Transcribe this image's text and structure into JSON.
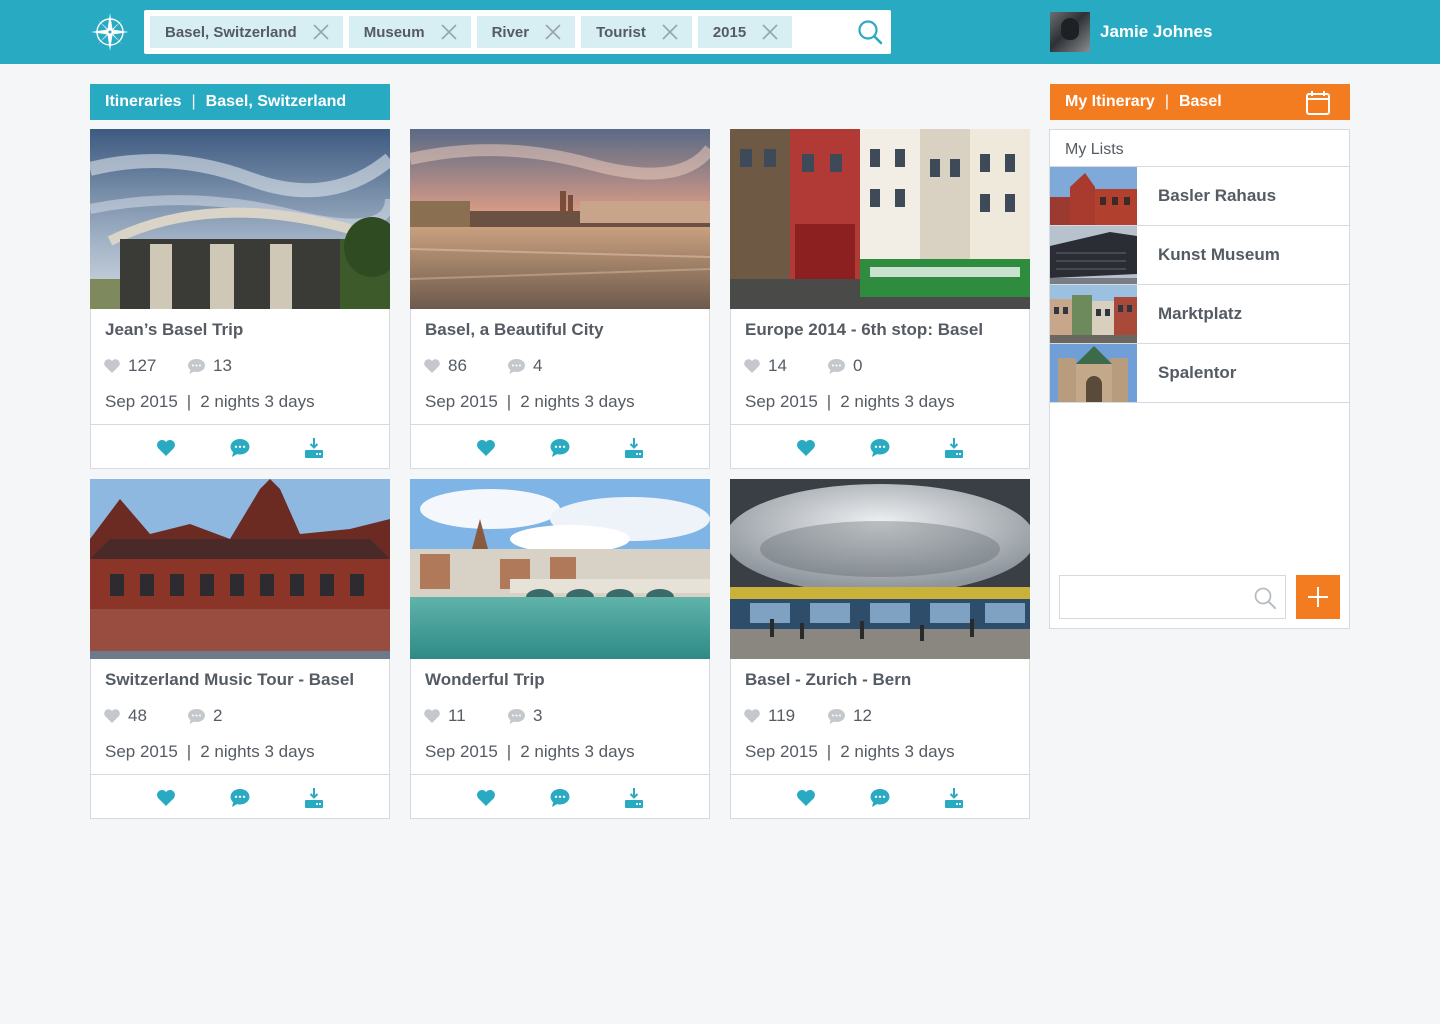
{
  "header": {
    "filters": [
      {
        "label": "Basel, Switzerland"
      },
      {
        "label": "Museum"
      },
      {
        "label": "River"
      },
      {
        "label": "Tourist"
      },
      {
        "label": "2015"
      }
    ],
    "user_name": "Jamie Johnes"
  },
  "section": {
    "title": "Itineraries",
    "separator": "|",
    "location": "Basel, Switzerland"
  },
  "cards": [
    {
      "title": "Jean’s Basel Trip",
      "likes": "127",
      "comments": "13",
      "date": "Sep 2015",
      "sep": "|",
      "duration": "2 nights 3 days"
    },
    {
      "title": "Basel, a Beautiful City",
      "likes": "86",
      "comments": "4",
      "date": "Sep 2015",
      "sep": "|",
      "duration": "2 nights 3 days"
    },
    {
      "title": "Europe 2014 - 6th stop: Basel",
      "likes": "14",
      "comments": "0",
      "date": "Sep 2015",
      "sep": "|",
      "duration": "2 nights 3 days"
    },
    {
      "title": "Switzerland Music Tour - Basel",
      "likes": "48",
      "comments": "2",
      "date": "Sep 2015",
      "sep": "|",
      "duration": "2 nights 3 days"
    },
    {
      "title": "Wonderful Trip",
      "likes": "11",
      "comments": "3",
      "date": "Sep 2015",
      "sep": "|",
      "duration": "2 nights 3 days"
    },
    {
      "title": "Basel - Zurich - Bern",
      "likes": "119",
      "comments": "12",
      "date": "Sep 2015",
      "sep": "|",
      "duration": "2 nights 3 days"
    }
  ],
  "panel": {
    "title": "My Itinerary",
    "separator": "|",
    "city": "Basel",
    "lists_label": "My Lists",
    "lists": [
      {
        "name": "Basler Rahaus"
      },
      {
        "name": "Kunst Museum"
      },
      {
        "name": "Marktplatz"
      },
      {
        "name": "Spalentor"
      }
    ],
    "search_value": ""
  },
  "colors": {
    "primary": "#28aac3",
    "accent": "#f47c20",
    "text": "#555b63",
    "chip_bg": "#d7eef3"
  },
  "icons": [
    "compass-logo-icon",
    "close-icon",
    "search-icon",
    "heart-icon",
    "comment-icon",
    "download-icon",
    "calendar-icon",
    "plus-icon"
  ]
}
